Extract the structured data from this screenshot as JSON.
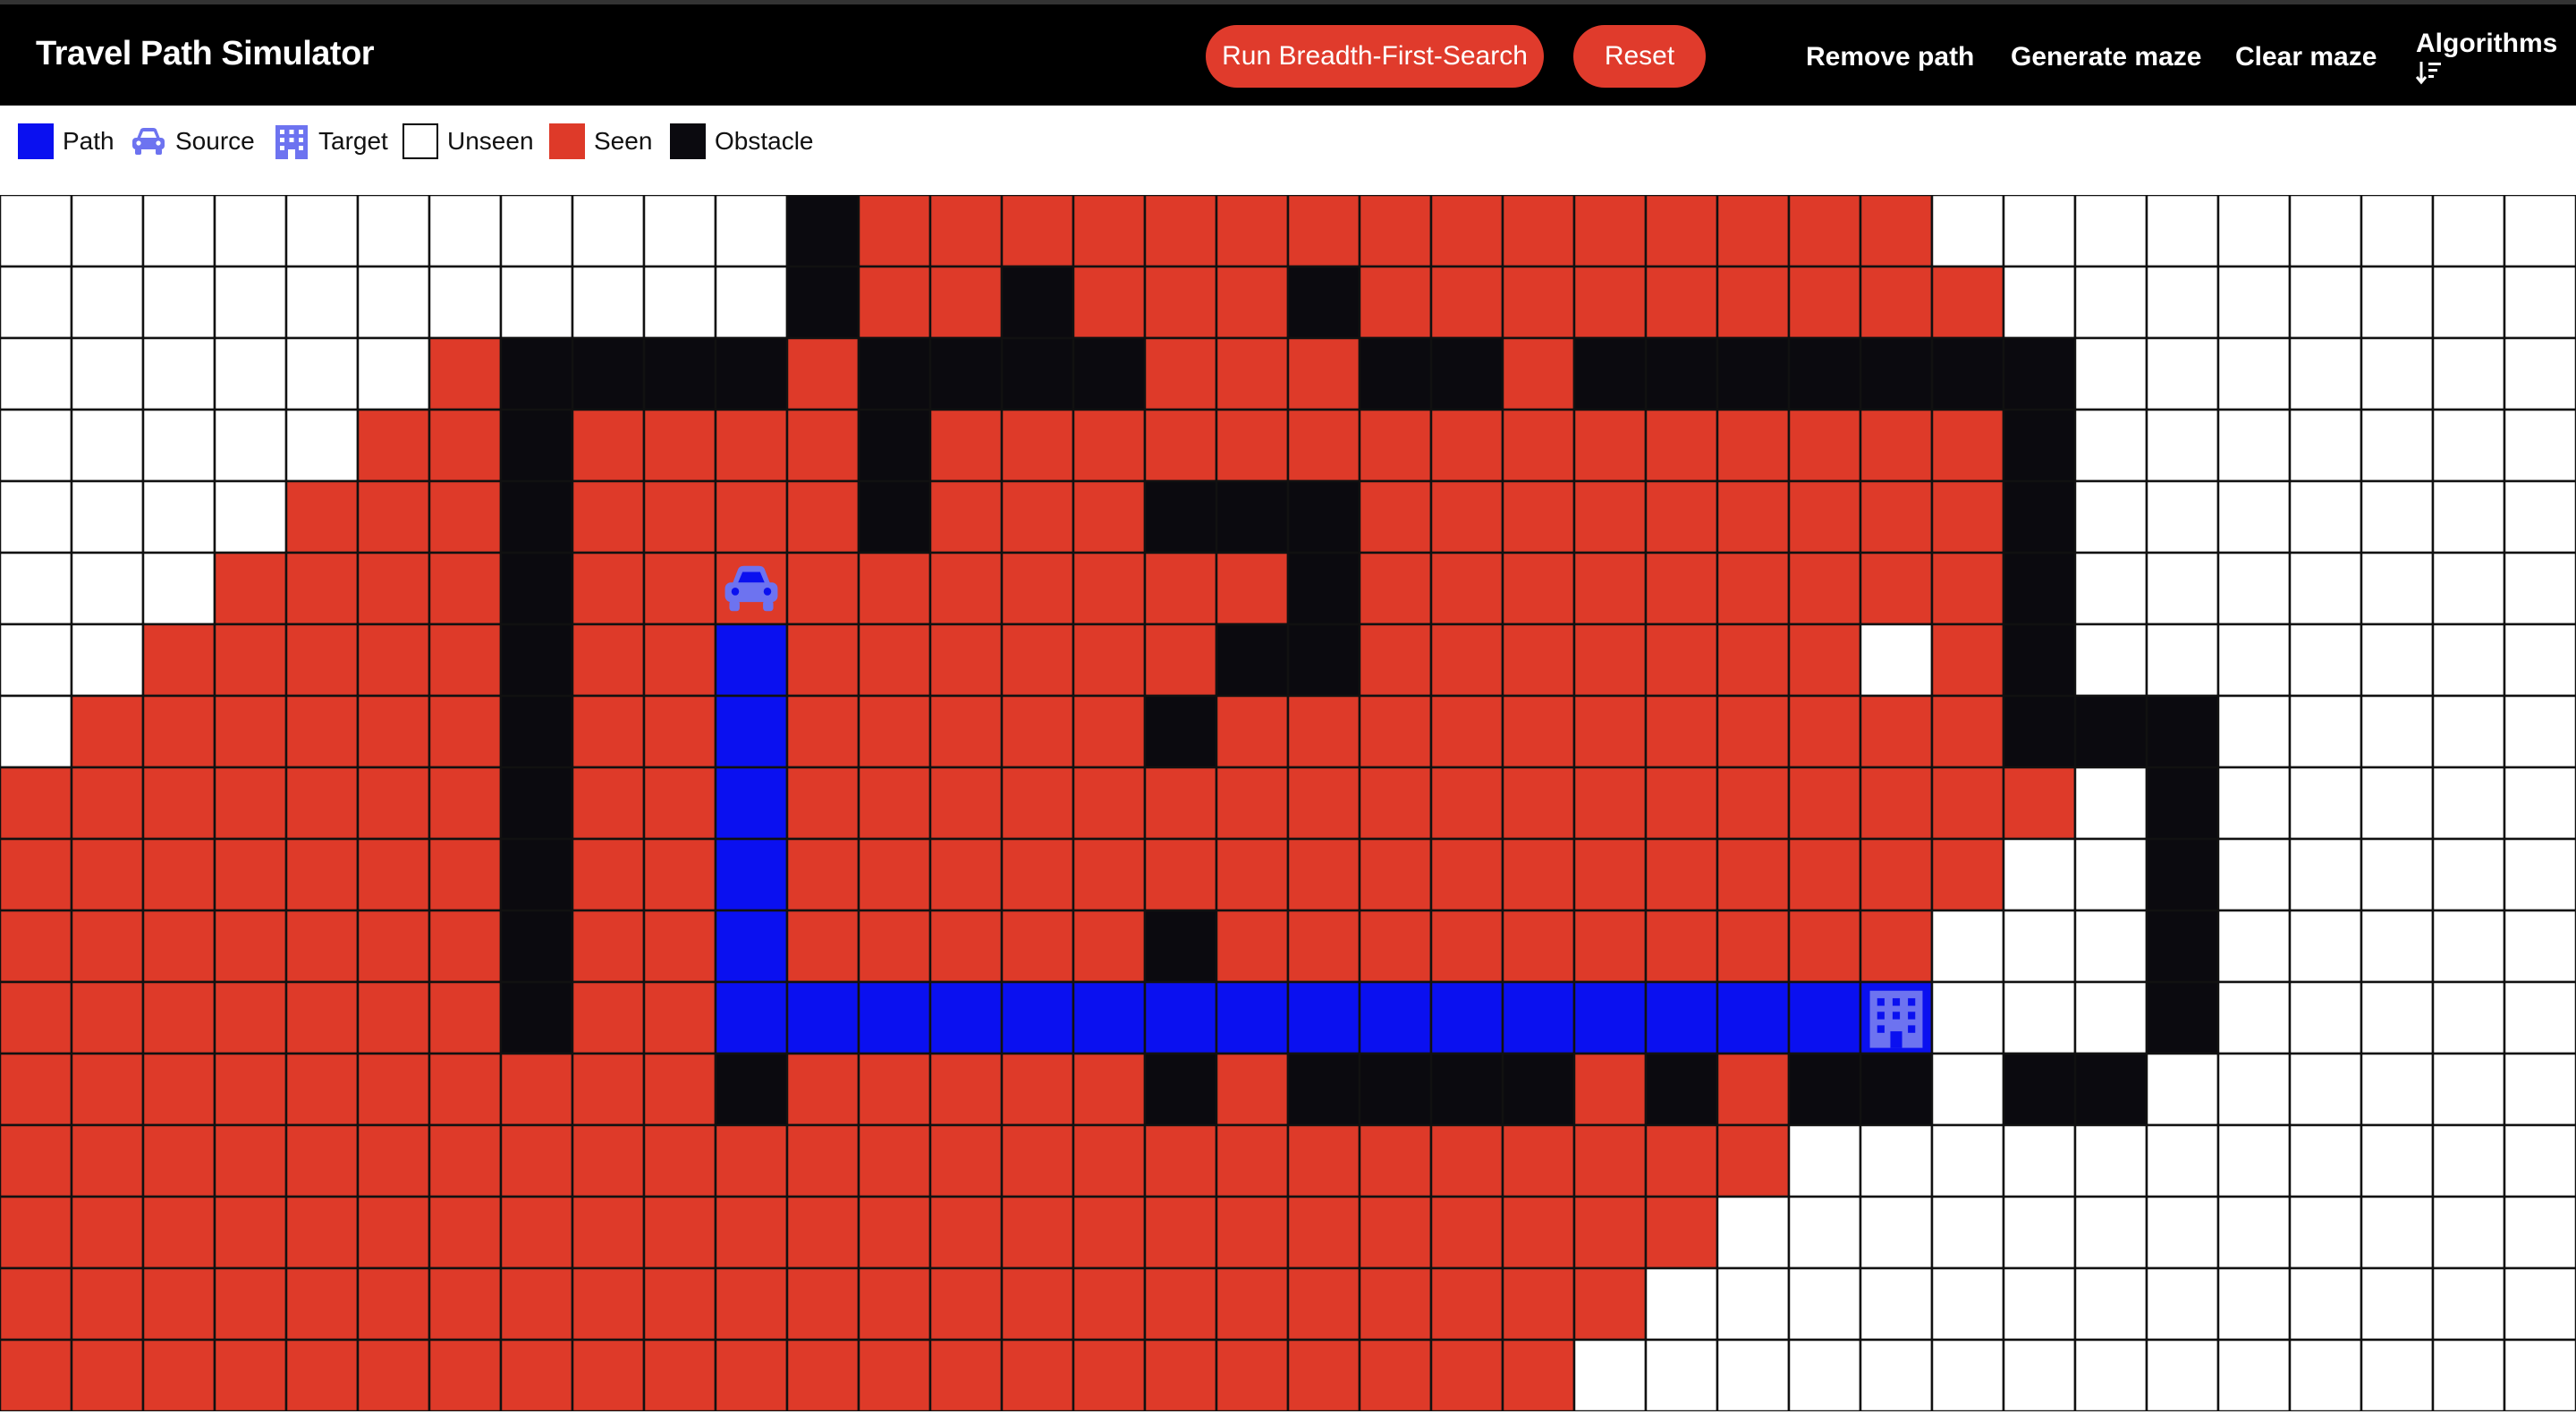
{
  "app": {
    "title": "Travel Path Simulator"
  },
  "toolbar": {
    "run_label": "Run Breadth-First-Search",
    "reset_label": "Reset",
    "remove_path_label": "Remove path",
    "generate_maze_label": "Generate maze",
    "clear_maze_label": "Clear maze",
    "algorithms_label": "Algorithms",
    "algorithms_icon": "sort-descending-icon"
  },
  "legend": {
    "path": "Path",
    "source": "Source",
    "target": "Target",
    "unseen": "Unseen",
    "seen": "Seen",
    "obstacle": "Obstacle"
  },
  "colors": {
    "path": "#0a10f0",
    "seen": "#de3a29",
    "unseen": "#ffffff",
    "obstacle": "#0b0a0f",
    "icon": "#6d73f0",
    "accent": "#e03b2c",
    "topbar": "#000000"
  },
  "grid": {
    "cols": 36,
    "rows": 17,
    "source": {
      "row": 5,
      "col": 10,
      "icon": "car-icon"
    },
    "target": {
      "row": 11,
      "col": 26,
      "icon": "building-icon"
    },
    "cells": [
      "UUUUUUUUUUUOSSSSSSSSSSSSSSSUUUUUUUUU",
      "UUUUUUUUUUUOSSOSSSOSSSSSSSSSUUUUUUUU",
      "UUUUUUSOOOOSOOOOSSSOOSOOOOOOOUUUUUUU",
      "UUUUUSSOSSSSOSSSSSSSSSSSSSSSOUUUUUUU",
      "UUUUSSSOSSSSOSSSOOOSSSSSSSSSOUUUUUUU",
      "UUUSSSSOSSSSSSSSSSOSSSSSSSSSOUUUUUUU",
      "UUSSSSSOSSPSSSSSSOOSSSSSSSUSOUUUUUUU",
      "USSSSSSOSSPSSSSSOSSSSSSSSSSSOOOUUUUU",
      "SSSSSSSOSSPSSSSSSSSSSSSSSSSSSUOUUUUU",
      "SSSSSSSOSSPSSSSSSSSSSSSSSSSSUUOUUUUU",
      "SSSSSSSOSSPSSSSSOSSSSSSSSSSUUUOUUUUU",
      "SSSSSSSOSSPPPPPPPPPPPPPPPPPUUUOUUUUU",
      "SSSSSSSSSSOSSSSSOSOOOOSOSOOUOOUUUUUU",
      "SSSSSSSSSSSSSSSSSSSSSSSSSUUUUUUUUUUU",
      "SSSSSSSSSSSSSSSSSSSSSSSSUUUUUUUUUUUU",
      "SSSSSSSSSSSSSSSSSSSSSSSUUUUUUUUUUUUU",
      "SSSSSSSSSSSSSSSSSSSSSSUUUUUUUUUUUUUU"
    ]
  }
}
